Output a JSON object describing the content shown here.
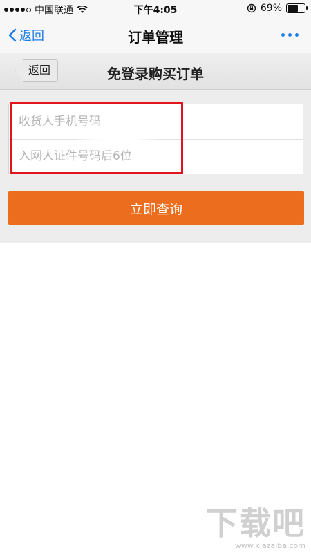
{
  "status_bar": {
    "carrier": "中国联通",
    "time": "下午4:05",
    "battery": "69%",
    "battery_level": 0.69
  },
  "nav_bar": {
    "back_label": "返回",
    "title": "订单管理"
  },
  "page": {
    "back_label": "返回",
    "title": "免登录购买订单"
  },
  "form": {
    "phone_placeholder": "收货人手机号码",
    "id_placeholder": "入网人证件号码后6位",
    "submit_label": "立即查询"
  },
  "watermark": {
    "logo": "下载吧",
    "url": "www.xiazaiba.com"
  },
  "colors": {
    "accent": "#1f7ee8",
    "button": "#ed6d1e",
    "highlight": "#e3141c"
  }
}
